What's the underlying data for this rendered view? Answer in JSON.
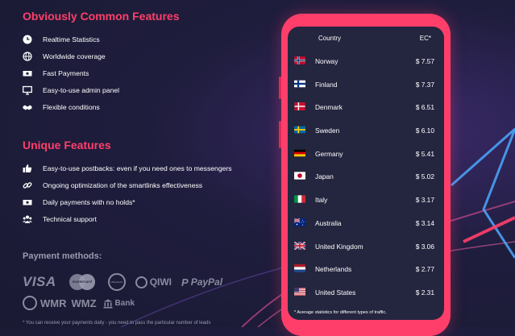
{
  "common_features": {
    "title": "Obviously Common Features",
    "items": [
      {
        "label": "Realtime Statistics",
        "icon": "clock-icon"
      },
      {
        "label": "Worldwide coverage",
        "icon": "globe-icon"
      },
      {
        "label": "Fast Payments",
        "icon": "cash-icon"
      },
      {
        "label": "Easy-to-use admin panel",
        "icon": "monitor-icon"
      },
      {
        "label": "Flexible conditions",
        "icon": "handshake-icon"
      }
    ]
  },
  "unique_features": {
    "title": "Unique Features",
    "items": [
      {
        "label": "Easy-to-use postbacks: even if you need ones to messengers",
        "icon": "thumbs-up-icon"
      },
      {
        "label": "Ongoing optimization of the smartlinks effectiveness",
        "icon": "link-icon"
      },
      {
        "label": "Daily payments with no holds*",
        "icon": "money-icon"
      },
      {
        "label": "Technical support",
        "icon": "users-icon"
      }
    ]
  },
  "payment": {
    "title": "Payment methods:",
    "methods_row1": [
      "VISA",
      "mastercard",
      "ePayments",
      "QIWI",
      "PayPal"
    ],
    "methods_row2": [
      "WMR",
      "WMZ",
      "Bank"
    ],
    "footnote": "* You can receive your payments daily - you need to pass the particular number of leads"
  },
  "table": {
    "header_country": "Country",
    "header_ec": "EC*",
    "rows": [
      {
        "country": "Norway",
        "value": "$ 7.57",
        "flag": "norway"
      },
      {
        "country": "Finland",
        "value": "$ 7.37",
        "flag": "finland"
      },
      {
        "country": "Denmark",
        "value": "$ 6.51",
        "flag": "denmark"
      },
      {
        "country": "Sweden",
        "value": "$ 6.10",
        "flag": "sweden"
      },
      {
        "country": "Germany",
        "value": "$ 5.41",
        "flag": "germany"
      },
      {
        "country": "Japan",
        "value": "$ 5.02",
        "flag": "japan"
      },
      {
        "country": "Italy",
        "value": "$ 3.17",
        "flag": "italy"
      },
      {
        "country": "Australia",
        "value": "$ 3.14",
        "flag": "australia"
      },
      {
        "country": "United Kingdom",
        "value": "$ 3.06",
        "flag": "uk"
      },
      {
        "country": "Netherlands",
        "value": "$ 2.77",
        "flag": "netherlands"
      },
      {
        "country": "United States",
        "value": "$ 2.31",
        "flag": "usa"
      }
    ],
    "note": "* Average statistics for different types of traffic."
  },
  "colors": {
    "accent": "#ff3f6a",
    "background": "#1f1d3d",
    "screen": "#24253f"
  }
}
